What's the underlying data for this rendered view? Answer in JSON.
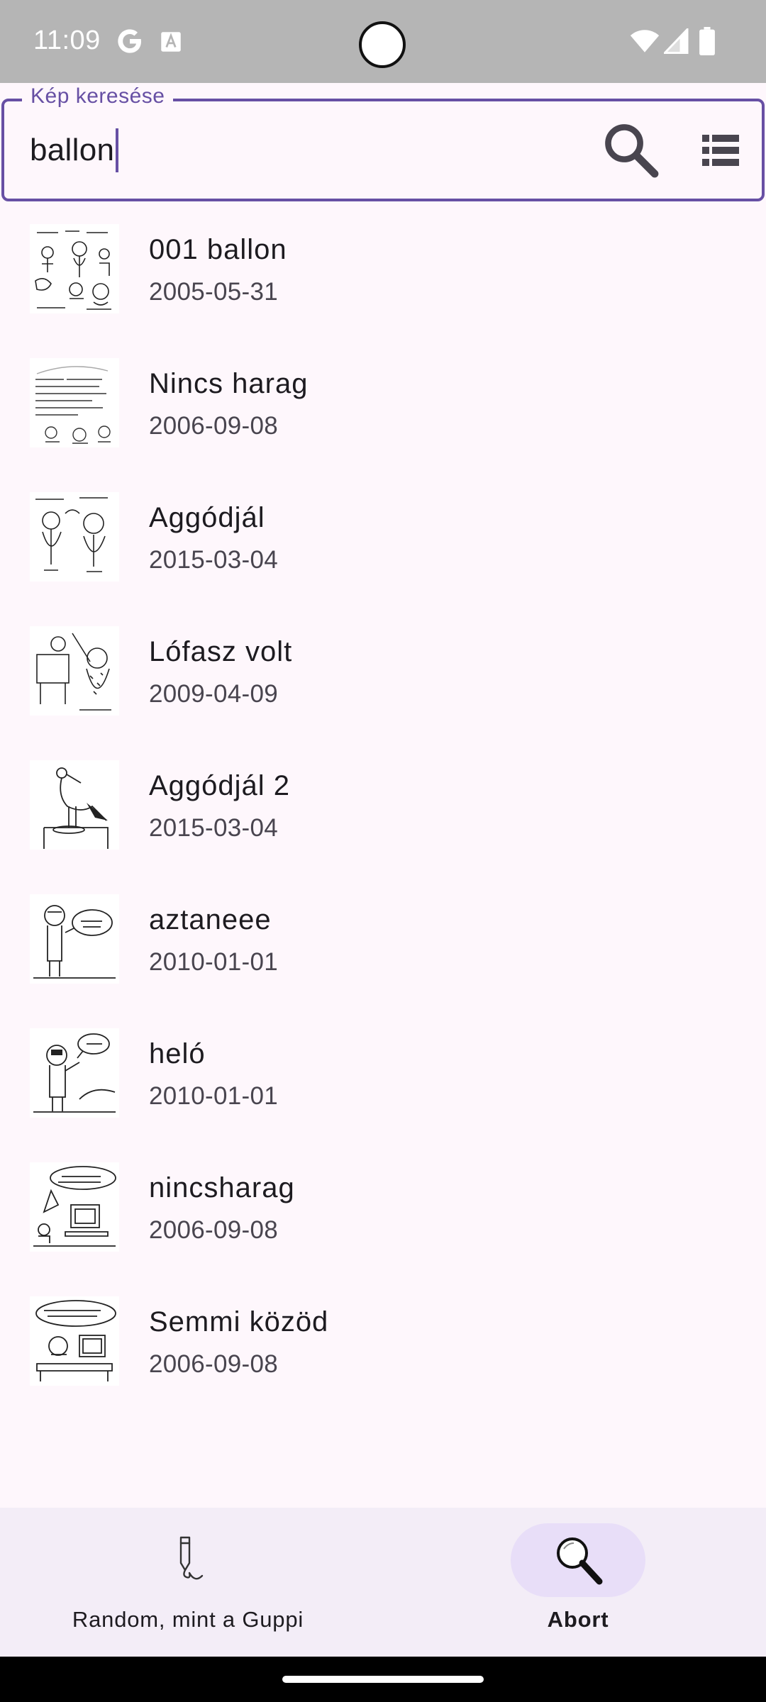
{
  "status_bar": {
    "time": "11:09"
  },
  "search": {
    "label": "Kép keresése",
    "value": "ballon",
    "search_icon": "search-icon",
    "list_icon": "list-view-icon"
  },
  "results": [
    {
      "title": "001 ballon",
      "date": "2005-05-31"
    },
    {
      "title": "Nincs harag",
      "date": "2006-09-08"
    },
    {
      "title": "Aggódjál",
      "date": "2015-03-04"
    },
    {
      "title": "Lófasz volt",
      "date": "2009-04-09"
    },
    {
      "title": "Aggódjál 2",
      "date": "2015-03-04"
    },
    {
      "title": "aztaneee",
      "date": "2010-01-01"
    },
    {
      "title": "heló",
      "date": "2010-01-01"
    },
    {
      "title": "nincsharag",
      "date": "2006-09-08"
    },
    {
      "title": "Semmi közöd",
      "date": "2006-09-08"
    }
  ],
  "bottom_nav": {
    "random_label": "Random, mint a Guppi",
    "abort_label": "Abort",
    "selected": "Abort"
  },
  "colors": {
    "accent": "#6750a4",
    "background": "#fef7fc",
    "nav_background": "#f3edf7",
    "active_pill": "#e8def8",
    "status_bar": "#b5b5b5"
  }
}
